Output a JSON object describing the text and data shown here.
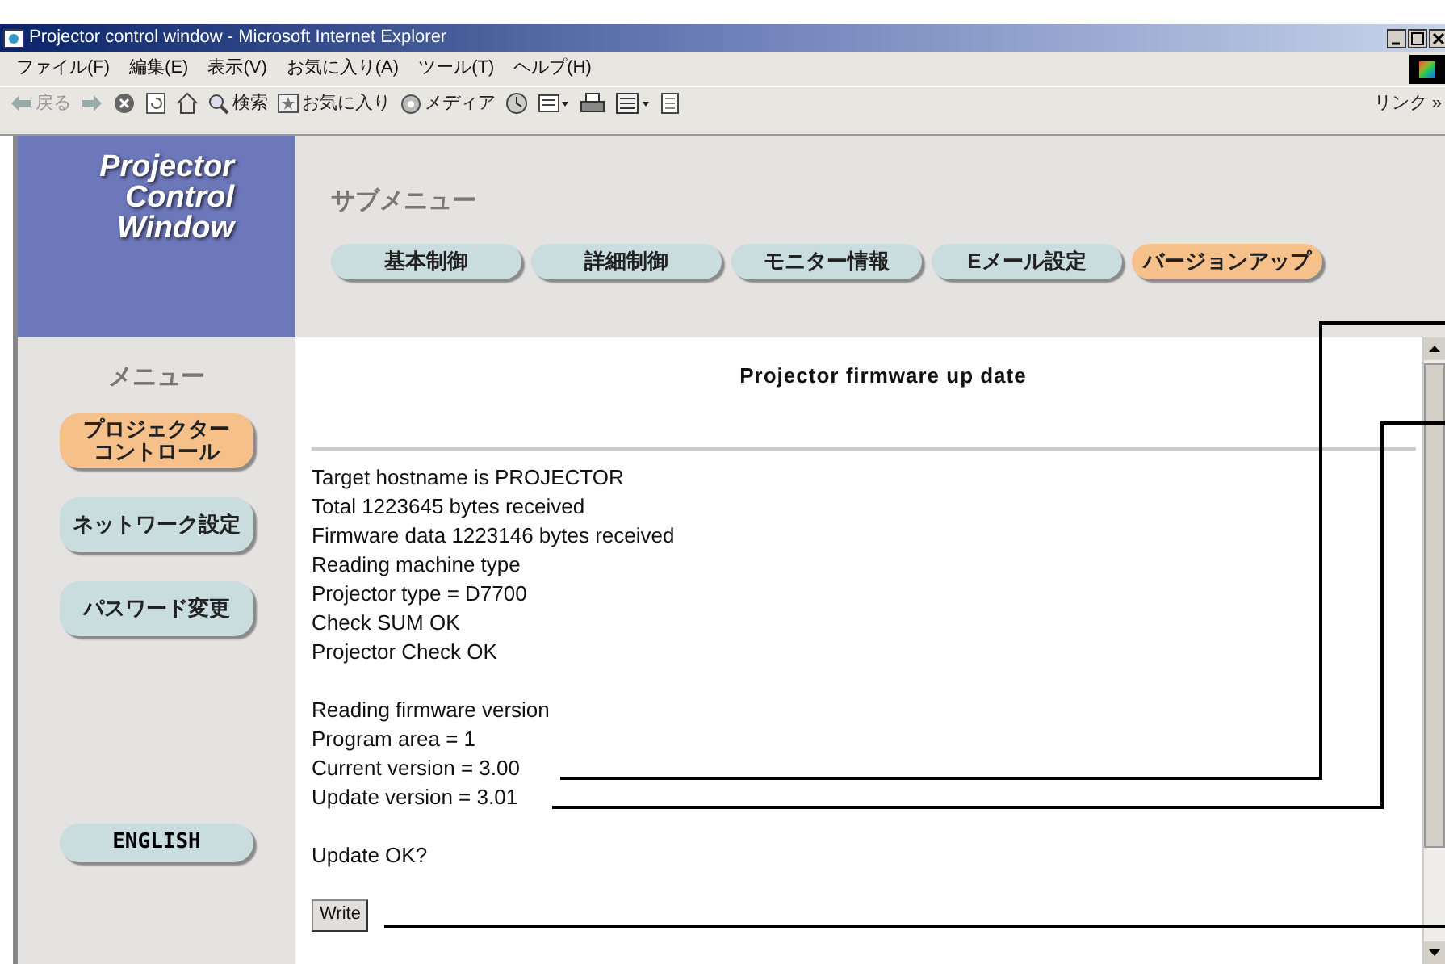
{
  "window": {
    "title": "Projector control window - Microsoft Internet Explorer"
  },
  "menu_bar": [
    "ファイル(F)",
    "編集(E)",
    "表示(V)",
    "お気に入り(A)",
    "ツール(T)",
    "ヘルプ(H)"
  ],
  "toolbar": [
    {
      "kind": "back",
      "label": "戻る"
    },
    {
      "kind": "forward"
    },
    {
      "kind": "stop"
    },
    {
      "kind": "refresh"
    },
    {
      "kind": "home"
    },
    {
      "kind": "search",
      "label": "検索"
    },
    {
      "kind": "favorites",
      "label": "お気に入り"
    },
    {
      "kind": "media",
      "label": "メディア"
    },
    {
      "kind": "history"
    },
    {
      "kind": "mail"
    },
    {
      "kind": "print"
    },
    {
      "kind": "edit"
    },
    {
      "kind": "discuss"
    }
  ],
  "links": {
    "label": "リンク",
    "chevron": "»"
  },
  "logo": [
    "Projector",
    "Control",
    "Window"
  ],
  "submenu": {
    "title": "サブメニュー",
    "tabs": [
      {
        "label": "基本制御",
        "selected": false
      },
      {
        "label": "詳細制御",
        "selected": false
      },
      {
        "label": "モニター情報",
        "selected": false
      },
      {
        "label": "Eメール設定",
        "selected": false
      },
      {
        "label": "バージョンアップ",
        "selected": true
      }
    ]
  },
  "sidebar": {
    "title": "メニュー",
    "items": [
      {
        "lines": [
          "プロジェクター",
          "コントロール"
        ],
        "selected": true
      },
      {
        "lines": [
          "ネットワーク設定"
        ],
        "selected": false
      },
      {
        "lines": [
          "パスワード変更"
        ],
        "selected": false
      }
    ],
    "language": "ENGLISH"
  },
  "content": {
    "heading": "Projector firmware up date",
    "log": [
      [
        "Target hostname is PROJECTOR",
        "Total 1223645 bytes received",
        "Firmware data 1223146 bytes received",
        "Reading machine type",
        "Projector type = D7700",
        "Check SUM OK",
        "Projector Check OK"
      ],
      [
        "Reading firmware version",
        "Program area = 1",
        "Current version = 3.00",
        "Update version = 3.01"
      ],
      [
        "Update OK?"
      ]
    ],
    "button": "Write"
  }
}
